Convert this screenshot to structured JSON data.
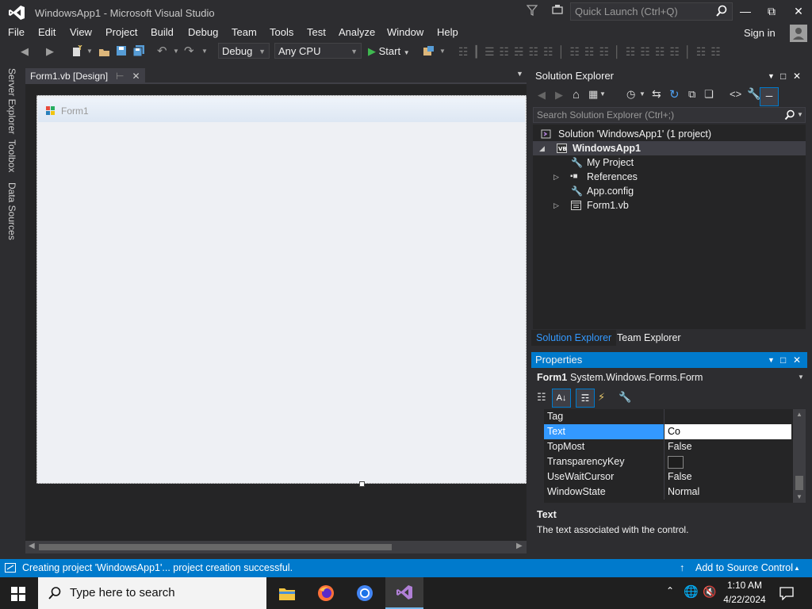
{
  "app": {
    "title": "WindowsApp1 - Microsoft Visual Studio",
    "quick_launch_placeholder": "Quick Launch (Ctrl+Q)",
    "sign_in": "Sign in"
  },
  "menu": [
    "File",
    "Edit",
    "View",
    "Project",
    "Build",
    "Debug",
    "Team",
    "Tools",
    "Test",
    "Analyze",
    "Window",
    "Help"
  ],
  "toolbar": {
    "config": "Debug",
    "platform": "Any CPU",
    "start": "Start"
  },
  "left_rail": [
    "Server Explorer",
    "Toolbox",
    "Data Sources"
  ],
  "document": {
    "tab_label": "Form1.vb [Design]",
    "form_title": "Form1"
  },
  "solution_explorer": {
    "title": "Solution Explorer",
    "search_placeholder": "Search Solution Explorer (Ctrl+;)",
    "tree": [
      {
        "label": "Solution 'WindowsApp1' (1 project)"
      },
      {
        "label": "WindowsApp1"
      },
      {
        "label": "My Project"
      },
      {
        "label": "References"
      },
      {
        "label": "App.config"
      },
      {
        "label": "Form1.vb"
      }
    ],
    "tabs": [
      "Solution Explorer",
      "Team Explorer"
    ]
  },
  "properties": {
    "title": "Properties",
    "object_name": "Form1",
    "object_type": "System.Windows.Forms.Form",
    "rows": [
      {
        "name": "Tag",
        "value": ""
      },
      {
        "name": "Text",
        "value": "Co"
      },
      {
        "name": "TopMost",
        "value": "False"
      },
      {
        "name": "TransparencyKey",
        "value": ""
      },
      {
        "name": "UseWaitCursor",
        "value": "False"
      },
      {
        "name": "WindowState",
        "value": "Normal"
      }
    ],
    "desc_title": "Text",
    "desc_text": "The text associated with the control."
  },
  "status": {
    "message": "Creating project 'WindowsApp1'... project creation successful.",
    "source_control": "Add to Source Control"
  },
  "taskbar": {
    "search_placeholder": "Type here to search",
    "time": "1:10 AM",
    "date": "4/22/2024"
  },
  "colors": {
    "accent": "#007acc",
    "background": "#2d2d30",
    "panel": "#252526"
  }
}
